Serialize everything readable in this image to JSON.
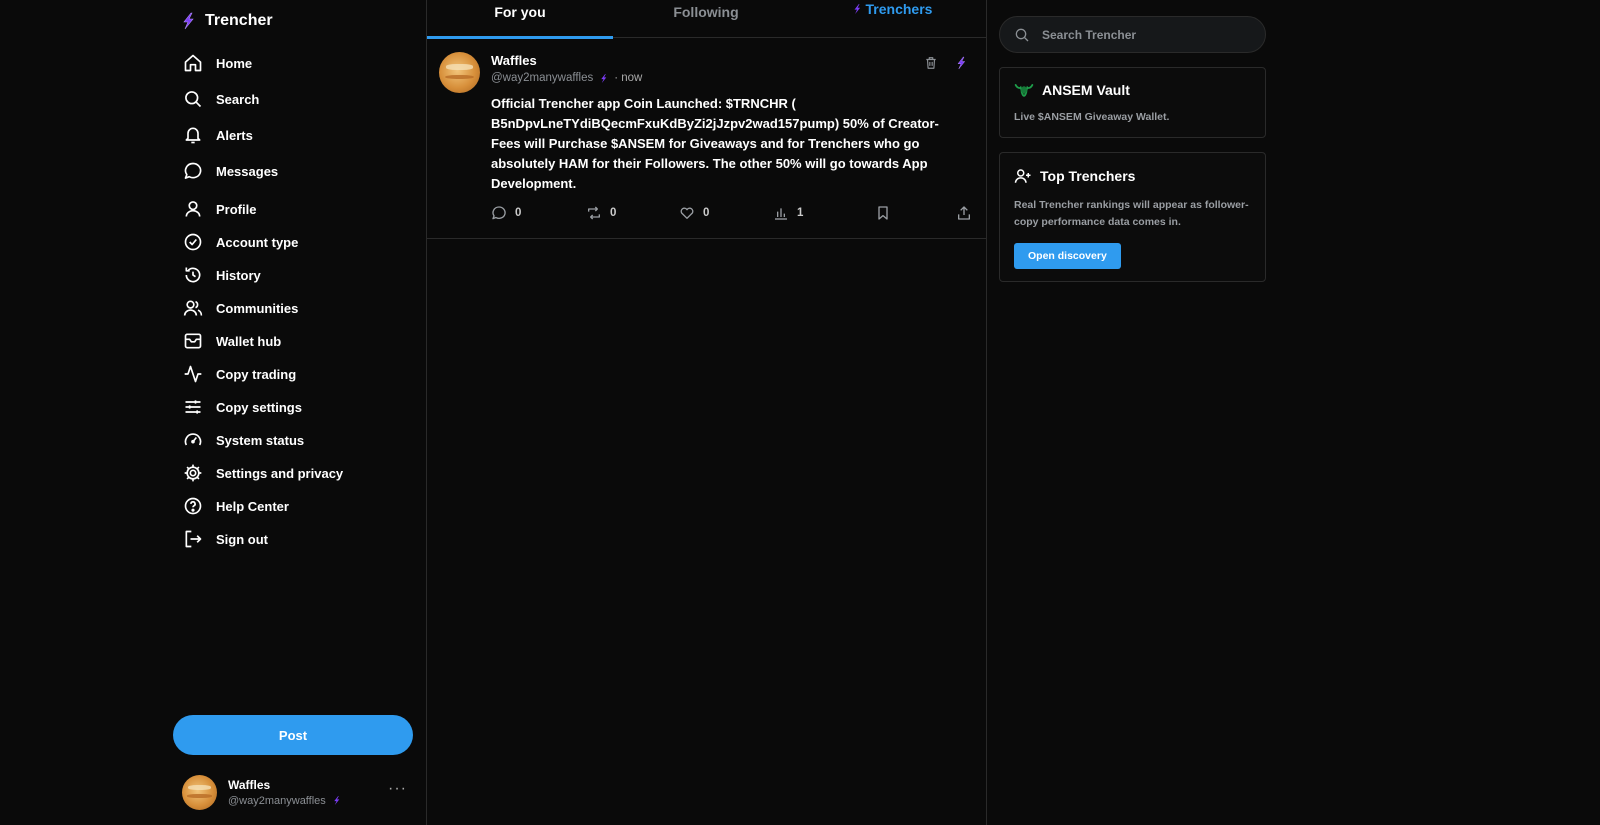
{
  "brand": {
    "name": "Trencher"
  },
  "nav": {
    "items": [
      {
        "label": "Home",
        "icon": "home-icon"
      },
      {
        "label": "Search",
        "icon": "search-icon"
      },
      {
        "label": "Alerts",
        "icon": "bell-icon"
      },
      {
        "label": "Messages",
        "icon": "message-icon"
      },
      {
        "label": "Profile",
        "icon": "user-icon"
      },
      {
        "label": "Account type",
        "icon": "check-circle-icon"
      },
      {
        "label": "History",
        "icon": "history-icon"
      },
      {
        "label": "Communities",
        "icon": "users-icon"
      },
      {
        "label": "Wallet hub",
        "icon": "wallet-icon"
      },
      {
        "label": "Copy trading",
        "icon": "activity-icon"
      },
      {
        "label": "Copy settings",
        "icon": "sliders-icon"
      },
      {
        "label": "System status",
        "icon": "gauge-icon"
      },
      {
        "label": "Settings and privacy",
        "icon": "gear-icon"
      },
      {
        "label": "Help Center",
        "icon": "help-icon"
      },
      {
        "label": "Sign out",
        "icon": "sign-out-icon"
      }
    ]
  },
  "post_button": {
    "label": "Post"
  },
  "account": {
    "name": "Waffles",
    "handle": "@way2manywaffles",
    "more": "···"
  },
  "tabs": [
    {
      "label": "For you",
      "state": "active"
    },
    {
      "label": "Following",
      "state": "inactive"
    },
    {
      "label": "Trenchers",
      "state": "highlight"
    }
  ],
  "post": {
    "author": "Waffles",
    "handle": "@way2manywaffles",
    "time": "· now",
    "body": "Official Trencher app Coin Launched: $TRNCHR ( B5nDpvLneTYdiBQecmFxuKdByZi2jJzpv2wad157pump) 50% of Creator-Fees will Purchase $ANSEM for Giveaways and for Trenchers who go absolutely HAM for their Followers. The other 50% will go towards App Development.",
    "replies": "0",
    "reposts": "0",
    "likes": "0",
    "views": "1"
  },
  "search": {
    "placeholder": "Search Trencher"
  },
  "vault": {
    "title": "ANSEM Vault",
    "subtitle": "Live $ANSEM Giveaway Wallet."
  },
  "top_trenchers": {
    "title": "Top Trenchers",
    "subtitle": "Real Trencher rankings will appear as follower-copy performance data comes in.",
    "button": "Open discovery"
  },
  "colors": {
    "accent": "#2f9bef",
    "bolt": "#7b3cf5",
    "background": "#0a0a0a"
  }
}
